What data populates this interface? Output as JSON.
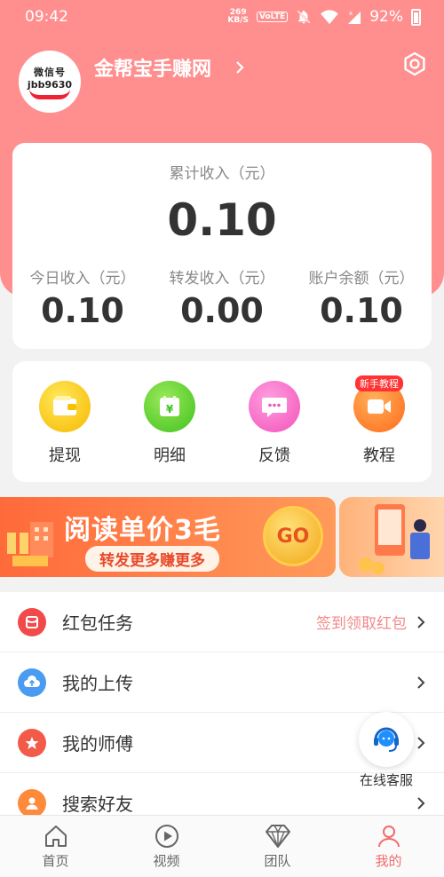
{
  "status_bar": {
    "time": "09:42",
    "net_speed_value": "269",
    "net_speed_unit": "KB/S",
    "volte": "VoLTE",
    "battery": "92%"
  },
  "profile": {
    "avatar_line1": "微信号",
    "avatar_line2": "jbb9630",
    "name": "金帮宝手赚网"
  },
  "income": {
    "total_label": "累计收入（元）",
    "total_value": "0.10",
    "today_label": "今日收入（元）",
    "today_value": "0.10",
    "forward_label": "转发收入（元）",
    "forward_value": "0.00",
    "balance_label": "账户余额（元）",
    "balance_value": "0.10"
  },
  "actions": {
    "withdraw": "提现",
    "detail": "明细",
    "feedback": "反馈",
    "tutorial": "教程",
    "tutorial_badge": "新手教程"
  },
  "banner": {
    "title": "阅读单价3毛",
    "subtitle": "转发更多赚更多",
    "go": "GO"
  },
  "menu": {
    "redpacket": "红包任务",
    "redpacket_hint": "签到领取红包",
    "uploads": "我的上传",
    "master": "我的师傅",
    "search_friends": "搜索好友"
  },
  "support": {
    "label": "在线客服"
  },
  "nav": {
    "home": "首页",
    "video": "视频",
    "team": "团队",
    "mine": "我的"
  },
  "colors": {
    "header": "#ff8f8f",
    "accent": "#f26b6b"
  }
}
